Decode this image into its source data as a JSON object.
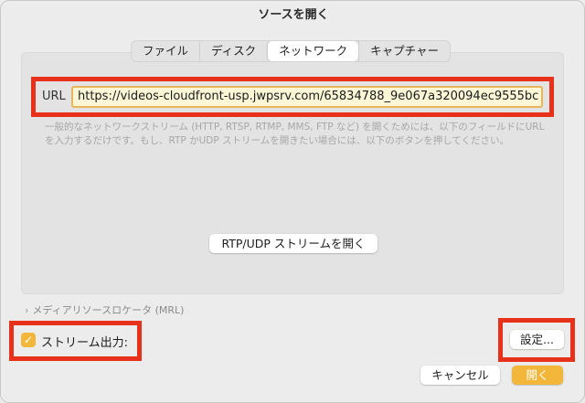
{
  "window": {
    "title": "ソースを開く"
  },
  "tabs": [
    {
      "label": "ファイル",
      "active": false
    },
    {
      "label": "ディスク",
      "active": false
    },
    {
      "label": "ネットワーク",
      "active": true
    },
    {
      "label": "キャプチャー",
      "active": false
    }
  ],
  "network": {
    "url_label": "URL",
    "url_value": "https://videos-cloudfront-usp.jwpsrv.com/65834788_9e067a320094ec9555bc",
    "help_text": "一般的なネットワークストリーム (HTTP, RTSP, RTMP, MMS, FTP など) を開くためには、以下のフィールドにURLを入力するだけです。もし、RTP かUDP ストリームを開きたい場合には、以下のボタンを押してください。",
    "rtp_button": "RTP/UDP ストリームを開く"
  },
  "mrl": {
    "chevron": "›",
    "label": "メディアリソースロケータ (MRL)"
  },
  "stream_output": {
    "label": "ストリーム出力:",
    "checked": true,
    "checkmark": "✓"
  },
  "buttons": {
    "settings": "設定...",
    "cancel": "キャンセル",
    "open": "開く"
  },
  "colors": {
    "accent": "#f2b73a",
    "highlight_frame": "#e8311b",
    "url_field_bg": "#fbf6d6"
  }
}
